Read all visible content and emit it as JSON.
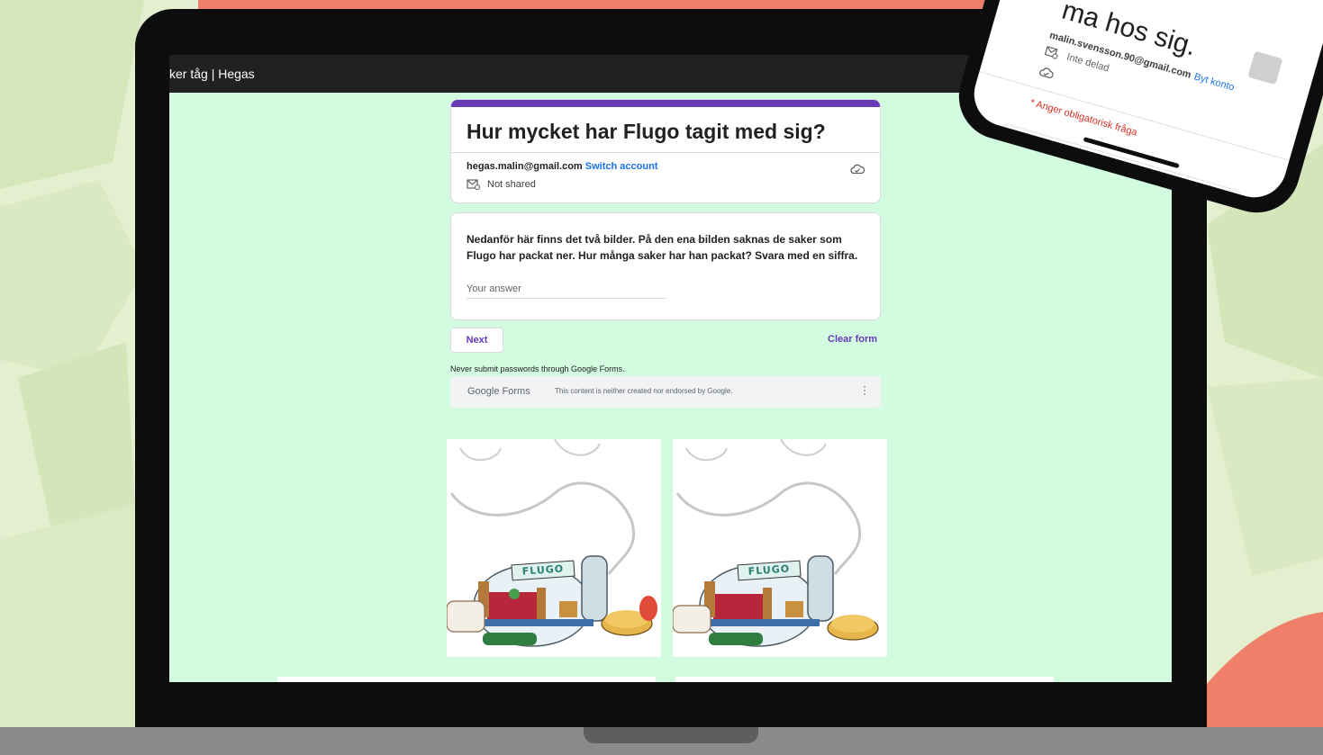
{
  "browser": {
    "tab_title": "ker tåg | Hegas"
  },
  "form": {
    "title": "Hur mycket har Flugo tagit med sig?",
    "account_email": "hegas.malin@gmail.com",
    "switch_account": "Switch account",
    "not_shared": "Not shared",
    "question": "Nedanför här finns det två bilder. På den ena bilden saknas de saker som Flugo har packat ner. Hur många saker har han packat? Svara med en siffra.",
    "answer_placeholder": "Your answer",
    "next_button": "Next",
    "clear_form": "Clear form",
    "password_warning": "Never submit passwords through Google Forms.",
    "footer_logo": "Google Forms",
    "footer_disclaimer": "This content is neither created nor endorsed by Google."
  },
  "illustrations": {
    "jar_label_left": "FLUGO",
    "jar_label_right": "FLUGO"
  },
  "phone": {
    "title_fragment": "ma hos sig.",
    "account_email": "malin.svensson.90@gmail.com",
    "switch_account": "Byt konto",
    "not_shared": "Inte delad",
    "required_note": "* Anger obligatorisk fråga"
  },
  "colors": {
    "accent": "#673ab7",
    "link": "#1a73e8",
    "form_background": "#d2fbdf",
    "page_background": "#e4efcf",
    "coral": "#f07f6a",
    "required": "#d93025"
  }
}
